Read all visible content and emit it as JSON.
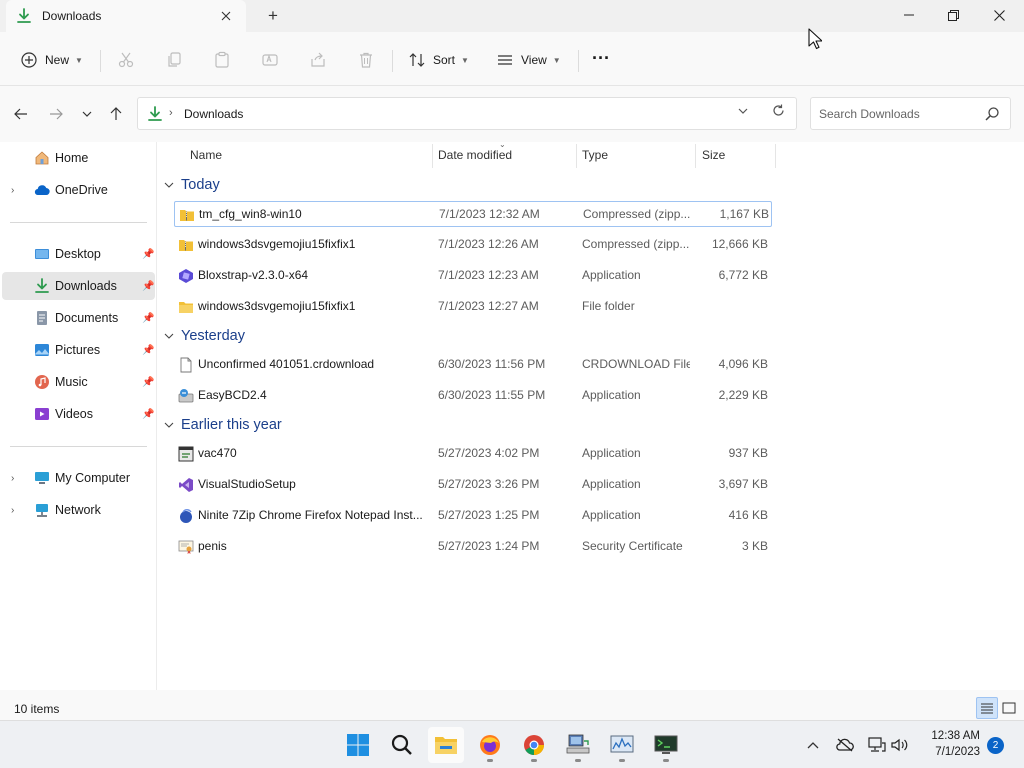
{
  "window": {
    "tab_title": "Downloads",
    "new_tab_symbol": "+"
  },
  "toolbar": {
    "new_label": "New",
    "sort_label": "Sort",
    "view_label": "View",
    "more_symbol": "···"
  },
  "address": {
    "path": "Downloads",
    "search_placeholder": "Search Downloads"
  },
  "sidebar": {
    "items": [
      {
        "label": "Home",
        "icon": "home-icon"
      },
      {
        "label": "OneDrive",
        "icon": "cloud-icon"
      },
      {
        "label": "Desktop",
        "icon": "desktop-icon",
        "pinned": true
      },
      {
        "label": "Downloads",
        "icon": "download-icon",
        "pinned": true,
        "active": true
      },
      {
        "label": "Documents",
        "icon": "documents-icon",
        "pinned": true
      },
      {
        "label": "Pictures",
        "icon": "pictures-icon",
        "pinned": true
      },
      {
        "label": "Music",
        "icon": "music-icon",
        "pinned": true
      },
      {
        "label": "Videos",
        "icon": "videos-icon",
        "pinned": true
      },
      {
        "label": "My Computer",
        "icon": "computer-icon"
      },
      {
        "label": "Network",
        "icon": "network-icon"
      }
    ]
  },
  "columns": {
    "name": "Name",
    "date": "Date modified",
    "type": "Type",
    "size": "Size"
  },
  "groups": [
    {
      "title": "Today",
      "files": [
        {
          "name": "tm_cfg_win8-win10",
          "date": "7/1/2023 12:32 AM",
          "type": "Compressed (zipp...",
          "size": "1,167 KB",
          "icon": "zip-folder-icon"
        },
        {
          "name": "windows3dsvgemojiu15fixfix1",
          "date": "7/1/2023 12:26 AM",
          "type": "Compressed (zipp...",
          "size": "12,666 KB",
          "icon": "zip-folder-icon"
        },
        {
          "name": "Bloxstrap-v2.3.0-x64",
          "date": "7/1/2023 12:23 AM",
          "type": "Application",
          "size": "6,772 KB",
          "icon": "bloxstrap-icon"
        },
        {
          "name": "windows3dsvgemojiu15fixfix1",
          "date": "7/1/2023 12:27 AM",
          "type": "File folder",
          "size": "",
          "icon": "folder-icon"
        }
      ]
    },
    {
      "title": "Yesterday",
      "files": [
        {
          "name": "Unconfirmed 401051.crdownload",
          "date": "6/30/2023 11:56 PM",
          "type": "CRDOWNLOAD File",
          "size": "4,096 KB",
          "icon": "file-icon"
        },
        {
          "name": "EasyBCD2.4",
          "date": "6/30/2023 11:55 PM",
          "type": "Application",
          "size": "2,229 KB",
          "icon": "installer-icon"
        }
      ]
    },
    {
      "title": "Earlier this year",
      "files": [
        {
          "name": "vac470",
          "date": "5/27/2023 4:02 PM",
          "type": "Application",
          "size": "937 KB",
          "icon": "app-window-icon"
        },
        {
          "name": "VisualStudioSetup",
          "date": "5/27/2023 3:26 PM",
          "type": "Application",
          "size": "3,697 KB",
          "icon": "visual-studio-icon"
        },
        {
          "name": "Ninite 7Zip Chrome Firefox Notepad Inst...",
          "date": "5/27/2023 1:25 PM",
          "type": "Application",
          "size": "416 KB",
          "icon": "ninite-icon"
        },
        {
          "name": "penis",
          "date": "5/27/2023 1:24 PM",
          "type": "Security Certificate",
          "size": "3 KB",
          "icon": "certificate-icon"
        }
      ]
    }
  ],
  "status": {
    "item_count": "10 items"
  },
  "taskbar": {
    "time": "12:38 AM",
    "date": "7/1/2023",
    "notifications": "2"
  },
  "colors": {
    "accent": "#0a64c8",
    "group_header": "#1b3f8b",
    "download_green": "#2e9b4f",
    "folder_yellow": "#f2c037"
  }
}
